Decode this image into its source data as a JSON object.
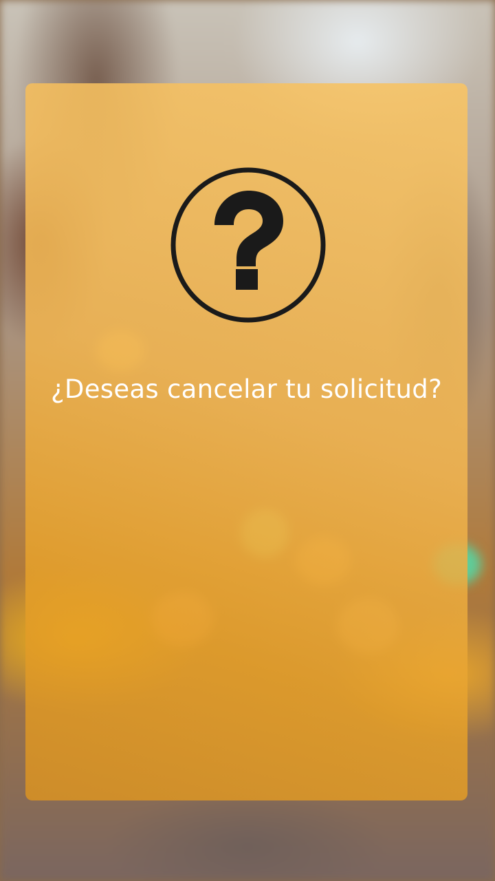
{
  "dialog": {
    "icon": "question-circle-icon",
    "message": "¿Deseas cancelar tu solicitud?"
  },
  "colors": {
    "card_overlay": "#F2B654",
    "icon": "#1A1A1A",
    "message_text": "#FFFFFF"
  }
}
